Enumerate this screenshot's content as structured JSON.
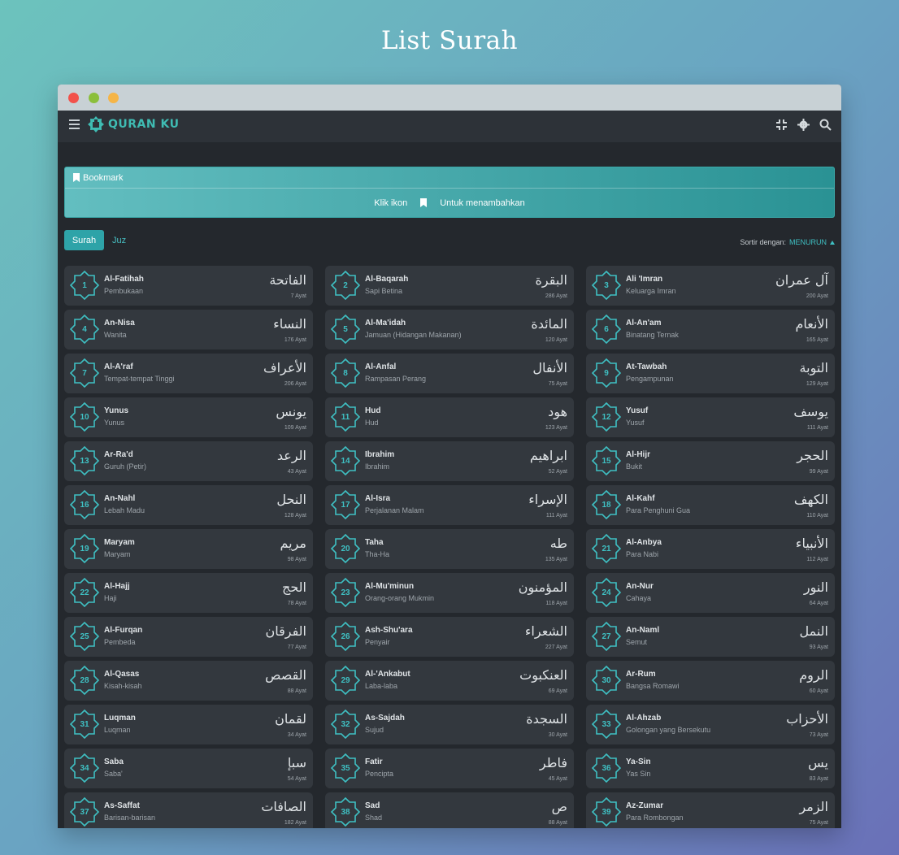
{
  "page_title": "List Surah",
  "app": {
    "name": "QURAN KU"
  },
  "bookmark": {
    "title": "Bookmark",
    "text_before": "Klik ikon",
    "text_after": "Untuk menambahkan"
  },
  "tabs": {
    "surah": "Surah",
    "juz": "Juz"
  },
  "sort": {
    "label": "Sortir dengan:",
    "value": "MENURUN"
  },
  "colors": {
    "accent": "#3fc0c3",
    "card": "#33383e",
    "bg": "#24282d"
  },
  "surahs": [
    {
      "num": "1",
      "name": "Al-Fatihah",
      "meaning": "Pembukaan",
      "arabic": "الفاتحة",
      "ayat": "7 Ayat"
    },
    {
      "num": "2",
      "name": "Al-Baqarah",
      "meaning": "Sapi Betina",
      "arabic": "البقرة",
      "ayat": "286 Ayat"
    },
    {
      "num": "3",
      "name": "Ali 'Imran",
      "meaning": "Keluarga Imran",
      "arabic": "آل عمران",
      "ayat": "200 Ayat"
    },
    {
      "num": "4",
      "name": "An-Nisa",
      "meaning": "Wanita",
      "arabic": "النساء",
      "ayat": "176 Ayat"
    },
    {
      "num": "5",
      "name": "Al-Ma'idah",
      "meaning": "Jamuan (Hidangan Makanan)",
      "arabic": "المائدة",
      "ayat": "120 Ayat"
    },
    {
      "num": "6",
      "name": "Al-An'am",
      "meaning": "Binatang Ternak",
      "arabic": "الأنعام",
      "ayat": "165 Ayat"
    },
    {
      "num": "7",
      "name": "Al-A'raf",
      "meaning": "Tempat-tempat Tinggi",
      "arabic": "الأعراف",
      "ayat": "206 Ayat"
    },
    {
      "num": "8",
      "name": "Al-Anfal",
      "meaning": "Rampasan Perang",
      "arabic": "الأنفال",
      "ayat": "75 Ayat"
    },
    {
      "num": "9",
      "name": "At-Tawbah",
      "meaning": "Pengampunan",
      "arabic": "التوبة",
      "ayat": "129 Ayat"
    },
    {
      "num": "10",
      "name": "Yunus",
      "meaning": "Yunus",
      "arabic": "يونس",
      "ayat": "109 Ayat"
    },
    {
      "num": "11",
      "name": "Hud",
      "meaning": "Hud",
      "arabic": "هود",
      "ayat": "123 Ayat"
    },
    {
      "num": "12",
      "name": "Yusuf",
      "meaning": "Yusuf",
      "arabic": "يوسف",
      "ayat": "111 Ayat"
    },
    {
      "num": "13",
      "name": "Ar-Ra'd",
      "meaning": "Guruh (Petir)",
      "arabic": "الرعد",
      "ayat": "43 Ayat"
    },
    {
      "num": "14",
      "name": "Ibrahim",
      "meaning": "Ibrahim",
      "arabic": "ابراهيم",
      "ayat": "52 Ayat"
    },
    {
      "num": "15",
      "name": "Al-Hijr",
      "meaning": "Bukit",
      "arabic": "الحجر",
      "ayat": "99 Ayat"
    },
    {
      "num": "16",
      "name": "An-Nahl",
      "meaning": "Lebah Madu",
      "arabic": "النحل",
      "ayat": "128 Ayat"
    },
    {
      "num": "17",
      "name": "Al-Isra",
      "meaning": "Perjalanan Malam",
      "arabic": "الإسراء",
      "ayat": "111 Ayat"
    },
    {
      "num": "18",
      "name": "Al-Kahf",
      "meaning": "Para Penghuni Gua",
      "arabic": "الكهف",
      "ayat": "110 Ayat"
    },
    {
      "num": "19",
      "name": "Maryam",
      "meaning": "Maryam",
      "arabic": "مريم",
      "ayat": "98 Ayat"
    },
    {
      "num": "20",
      "name": "Taha",
      "meaning": "Tha-Ha",
      "arabic": "طه",
      "ayat": "135 Ayat"
    },
    {
      "num": "21",
      "name": "Al-Anbya",
      "meaning": "Para Nabi",
      "arabic": "الأنبياء",
      "ayat": "112 Ayat"
    },
    {
      "num": "22",
      "name": "Al-Hajj",
      "meaning": "Haji",
      "arabic": "الحج",
      "ayat": "78 Ayat"
    },
    {
      "num": "23",
      "name": "Al-Mu'minun",
      "meaning": "Orang-orang Mukmin",
      "arabic": "المؤمنون",
      "ayat": "118 Ayat"
    },
    {
      "num": "24",
      "name": "An-Nur",
      "meaning": "Cahaya",
      "arabic": "النور",
      "ayat": "64 Ayat"
    },
    {
      "num": "25",
      "name": "Al-Furqan",
      "meaning": "Pembeda",
      "arabic": "الفرقان",
      "ayat": "77 Ayat"
    },
    {
      "num": "26",
      "name": "Ash-Shu'ara",
      "meaning": "Penyair",
      "arabic": "الشعراء",
      "ayat": "227 Ayat"
    },
    {
      "num": "27",
      "name": "An-Naml",
      "meaning": "Semut",
      "arabic": "النمل",
      "ayat": "93 Ayat"
    },
    {
      "num": "28",
      "name": "Al-Qasas",
      "meaning": "Kisah-kisah",
      "arabic": "القصص",
      "ayat": "88 Ayat"
    },
    {
      "num": "29",
      "name": "Al-'Ankabut",
      "meaning": "Laba-laba",
      "arabic": "العنكبوت",
      "ayat": "69 Ayat"
    },
    {
      "num": "30",
      "name": "Ar-Rum",
      "meaning": "Bangsa Romawi",
      "arabic": "الروم",
      "ayat": "60 Ayat"
    },
    {
      "num": "31",
      "name": "Luqman",
      "meaning": "Luqman",
      "arabic": "لقمان",
      "ayat": "34 Ayat"
    },
    {
      "num": "32",
      "name": "As-Sajdah",
      "meaning": "Sujud",
      "arabic": "السجدة",
      "ayat": "30 Ayat"
    },
    {
      "num": "33",
      "name": "Al-Ahzab",
      "meaning": "Golongan yang Bersekutu",
      "arabic": "الأحزاب",
      "ayat": "73 Ayat"
    },
    {
      "num": "34",
      "name": "Saba",
      "meaning": "Saba'",
      "arabic": "سبإ",
      "ayat": "54 Ayat"
    },
    {
      "num": "35",
      "name": "Fatir",
      "meaning": "Pencipta",
      "arabic": "فاطر",
      "ayat": "45 Ayat"
    },
    {
      "num": "36",
      "name": "Ya-Sin",
      "meaning": "Yas Sin",
      "arabic": "يس",
      "ayat": "83 Ayat"
    },
    {
      "num": "37",
      "name": "As-Saffat",
      "meaning": "Barisan-barisan",
      "arabic": "الصافات",
      "ayat": "182 Ayat"
    },
    {
      "num": "38",
      "name": "Sad",
      "meaning": "Shad",
      "arabic": "ص",
      "ayat": "88 Ayat"
    },
    {
      "num": "39",
      "name": "Az-Zumar",
      "meaning": "Para Rombongan",
      "arabic": "الزمر",
      "ayat": "75 Ayat"
    }
  ]
}
